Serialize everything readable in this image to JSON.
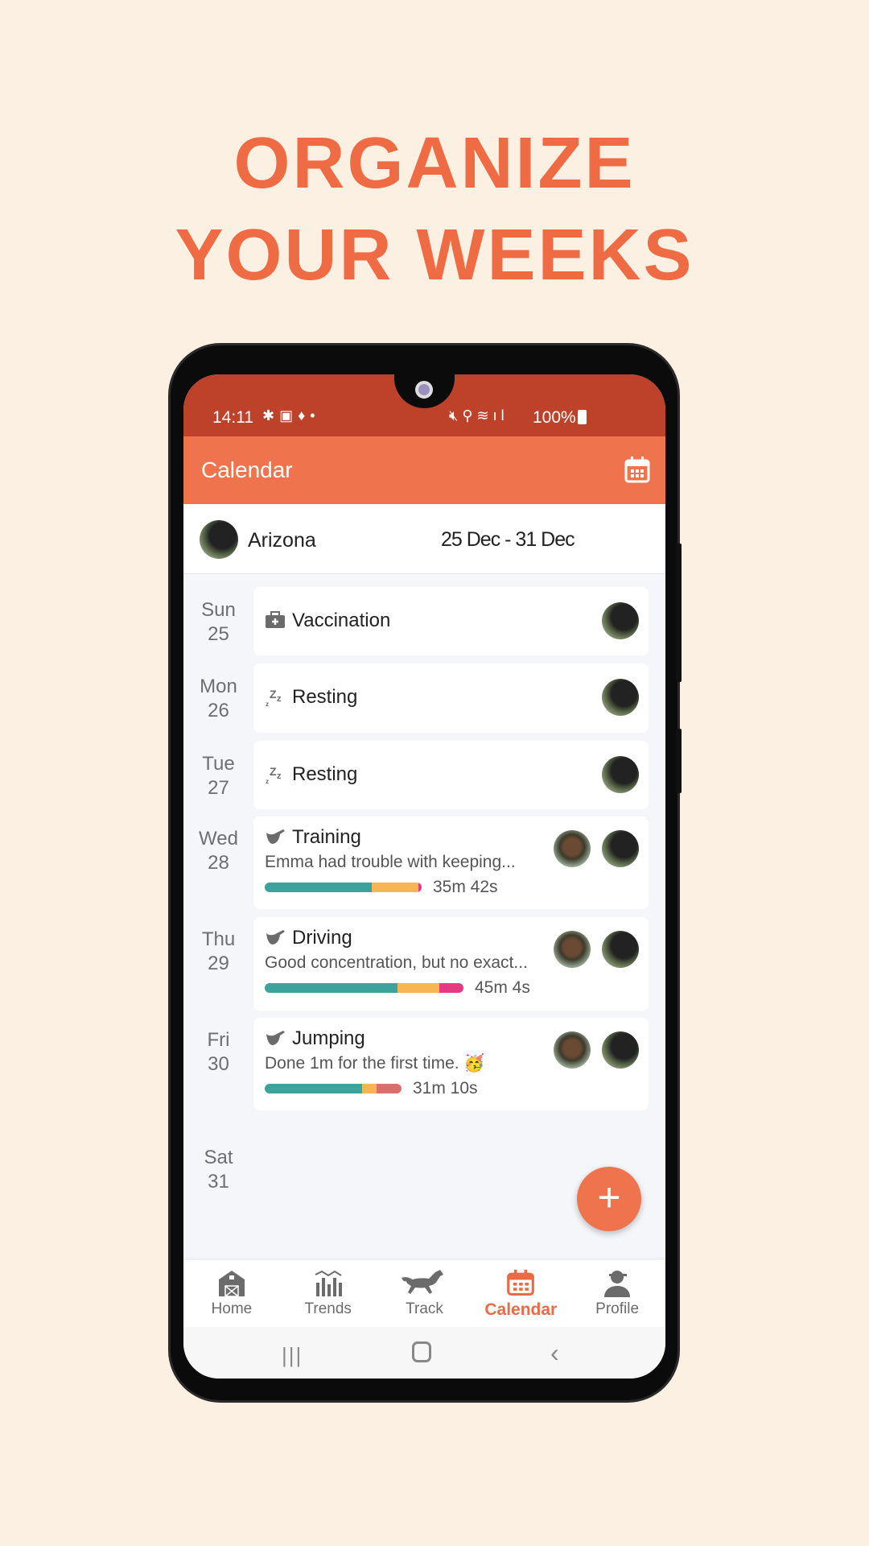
{
  "headline": [
    "ORGANIZE",
    "YOUR WEEKS"
  ],
  "status_bar": {
    "time": "14:11",
    "battery": "100%"
  },
  "app_bar": {
    "title": "Calendar",
    "action_icon": "calendar-icon"
  },
  "header": {
    "horse_name": "Arizona",
    "date_range": "25 Dec - 31 Dec"
  },
  "colors": {
    "accent": "#EF744E",
    "status": "#BE4129",
    "teal": "#3BA29C",
    "orange": "#F7B553",
    "pink": "#E33A83",
    "rose": "#D9706C"
  },
  "days": [
    {
      "dow": "Sun",
      "date": "25",
      "event": {
        "type": "vaccination",
        "icon": "medical-kit-icon",
        "title": "Vaccination",
        "avatars": [
          "horse"
        ]
      }
    },
    {
      "dow": "Mon",
      "date": "26",
      "event": {
        "type": "rest",
        "icon": "zzz-icon",
        "title": "Resting",
        "avatars": [
          "horse"
        ]
      }
    },
    {
      "dow": "Tue",
      "date": "27",
      "event": {
        "type": "rest",
        "icon": "zzz-icon",
        "title": "Resting",
        "avatars": [
          "horse"
        ]
      }
    },
    {
      "dow": "Wed",
      "date": "28",
      "event": {
        "type": "session",
        "icon": "saddle-icon",
        "title": "Training",
        "subtitle": "Emma had trouble with keeping...",
        "duration": "35m 42s",
        "gaits": [
          {
            "color": "#3BA29C",
            "fraction": 0.68
          },
          {
            "color": "#F7B553",
            "fraction": 0.3
          },
          {
            "color": "#E33A83",
            "fraction": 0.02
          }
        ],
        "avatars": [
          "rider",
          "horse"
        ]
      }
    },
    {
      "dow": "Thu",
      "date": "29",
      "event": {
        "type": "session",
        "icon": "saddle-icon",
        "title": "Driving",
        "subtitle": "Good concentration, but no exact...",
        "duration": "45m 4s",
        "gaits": [
          {
            "color": "#3BA29C",
            "fraction": 0.67
          },
          {
            "color": "#F7B553",
            "fraction": 0.21
          },
          {
            "color": "#E33A83",
            "fraction": 0.12
          }
        ],
        "avatars": [
          "rider",
          "horse"
        ]
      }
    },
    {
      "dow": "Fri",
      "date": "30",
      "event": {
        "type": "session",
        "icon": "saddle-icon",
        "title": "Jumping",
        "subtitle": "Done 1m for the first time. 🥳",
        "duration": "31m 10s",
        "gaits": [
          {
            "color": "#3BA29C",
            "fraction": 0.71
          },
          {
            "color": "#F7B553",
            "fraction": 0.11
          },
          {
            "color": "#D9706C",
            "fraction": 0.18
          }
        ],
        "avatars": [
          "rider",
          "horse"
        ]
      }
    },
    {
      "dow": "Sat",
      "date": "31"
    }
  ],
  "fab": {
    "label": "+"
  },
  "bottom_nav": [
    {
      "label": "Home",
      "icon": "barn-icon"
    },
    {
      "label": "Trends",
      "icon": "trends-icon"
    },
    {
      "label": "Track",
      "icon": "horse-icon"
    },
    {
      "label": "Calendar",
      "icon": "calendar-icon",
      "active": true
    },
    {
      "label": "Profile",
      "icon": "profile-icon"
    }
  ]
}
